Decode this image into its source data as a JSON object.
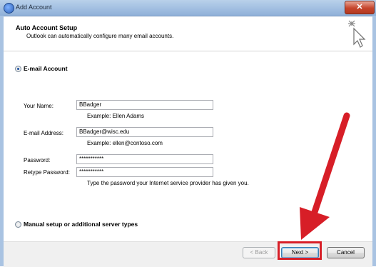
{
  "window": {
    "title": "Add Account",
    "close_label": "✕"
  },
  "header": {
    "title": "Auto Account Setup",
    "subtitle": "Outlook can automatically configure many email accounts."
  },
  "email_account": {
    "option_label": "E-mail Account",
    "your_name_label": "Your Name:",
    "your_name_value": "BBadger",
    "your_name_example": "Example: Ellen Adams",
    "email_label": "E-mail Address:",
    "email_value": "BBadger@wisc.edu",
    "email_example": "Example: ellen@contoso.com",
    "password_label": "Password:",
    "password_value": "***********",
    "retype_label": "Retype Password:",
    "retype_value": "***********",
    "password_hint": "Type the password your Internet service provider has given you."
  },
  "manual_option_label": "Manual setup or additional server types",
  "buttons": {
    "back": "< Back",
    "next": "Next >",
    "cancel": "Cancel"
  },
  "colors": {
    "annotation": "#d71e27",
    "titlebar": "#a6c2e3"
  }
}
